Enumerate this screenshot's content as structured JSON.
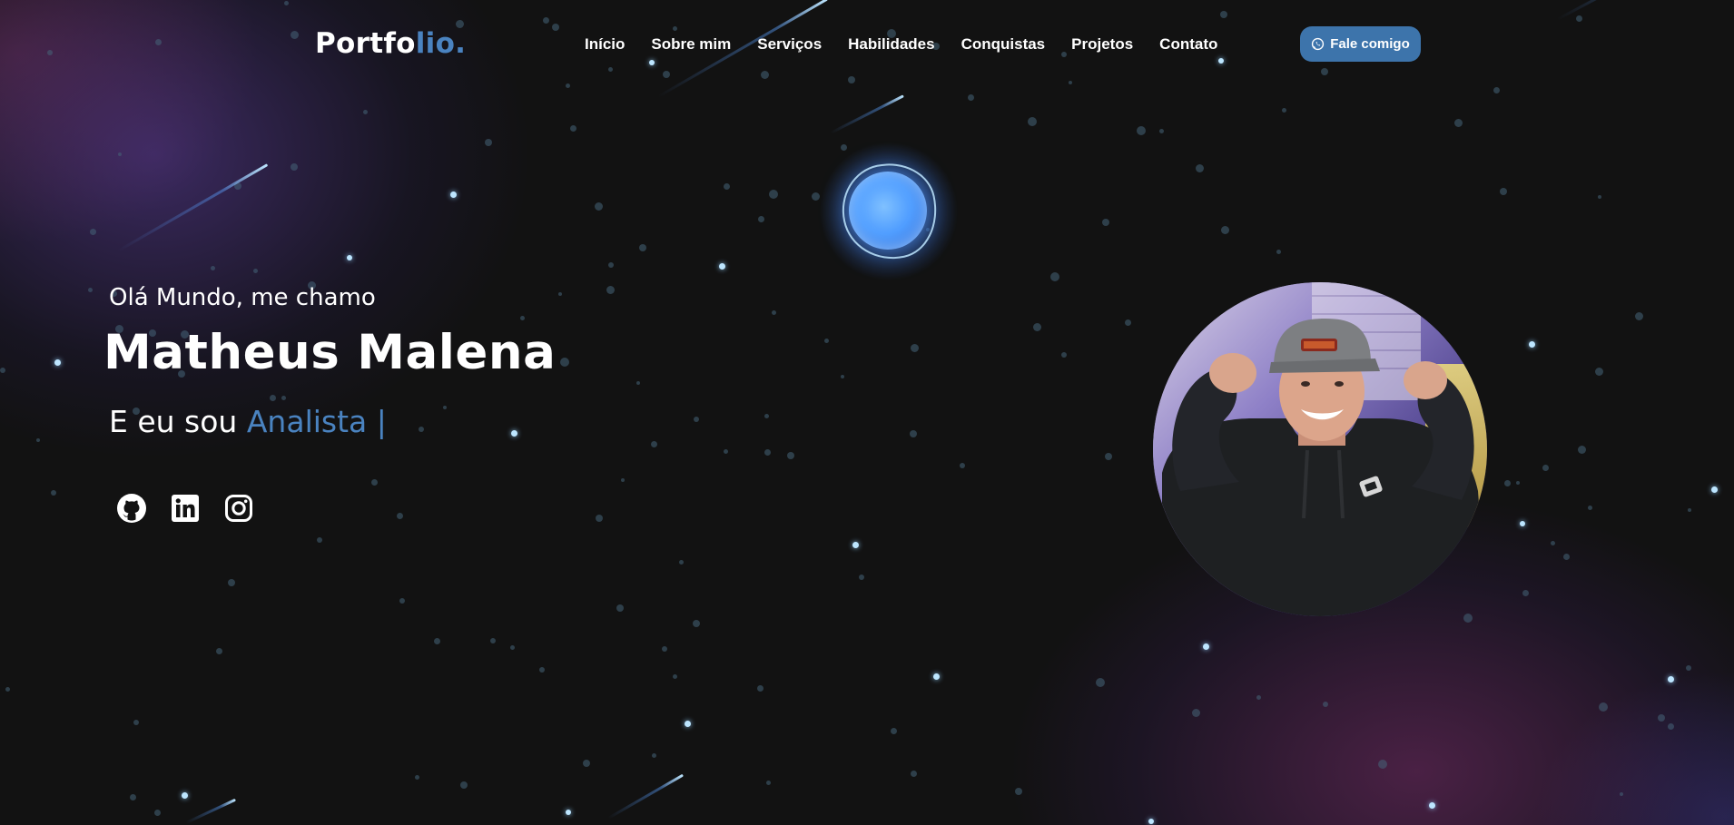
{
  "navbar": {
    "logo_main": "Portfo",
    "logo_accent": "lio.",
    "links": [
      "Início",
      "Sobre mim",
      "Serviços",
      "Habilidades",
      "Conquistas",
      "Projetos",
      "Contato"
    ],
    "cta_label": "Fale comigo",
    "cta_icon": "whatsapp-icon"
  },
  "hero": {
    "greeting": "Olá Mundo, me chamo",
    "name": "Matheus Malena",
    "role_prefix": "E eu sou",
    "role_word": "Analista |",
    "socials": [
      {
        "icon": "github-icon"
      },
      {
        "icon": "linkedin-icon"
      },
      {
        "icon": "instagram-icon"
      }
    ]
  },
  "profile_photo": {
    "alt": "profile photo"
  },
  "colors": {
    "background": "#121212",
    "accent": "#4a83c0",
    "button": "#3d74ab",
    "text": "#ffffff"
  }
}
